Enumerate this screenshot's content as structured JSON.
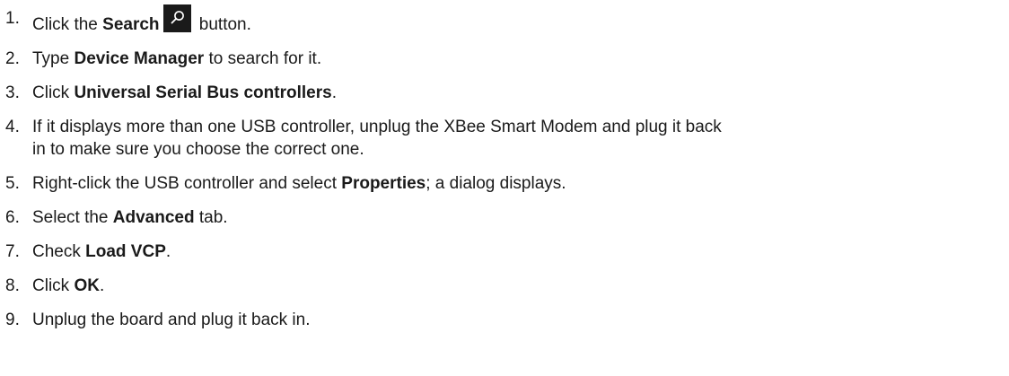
{
  "steps": [
    {
      "num": "1.",
      "pre": "Click the ",
      "bold": "Search",
      "icon": "search-icon",
      "post": " button."
    },
    {
      "num": "2.",
      "pre": "Type ",
      "bold": "Device Manager",
      "post": " to search for it."
    },
    {
      "num": "3.",
      "pre": "Click ",
      "bold": "Universal Serial Bus controllers",
      "post": "."
    },
    {
      "num": "4.",
      "text_line1": "If it displays more than one USB controller, unplug the XBee Smart Modem and plug it back",
      "text_line2": "in to make sure you choose the correct one."
    },
    {
      "num": "5.",
      "pre": "Right-click the USB controller and select ",
      "bold": "Properties",
      "post": "; a dialog displays."
    },
    {
      "num": "6.",
      "pre": "Select the ",
      "bold": "Advanced",
      "post": " tab."
    },
    {
      "num": "7.",
      "pre": "Check ",
      "bold": "Load VCP",
      "post": "."
    },
    {
      "num": "8.",
      "pre": "Click ",
      "bold": "OK",
      "post": "."
    },
    {
      "num": "9.",
      "text": "Unplug the board and plug it back in."
    }
  ]
}
